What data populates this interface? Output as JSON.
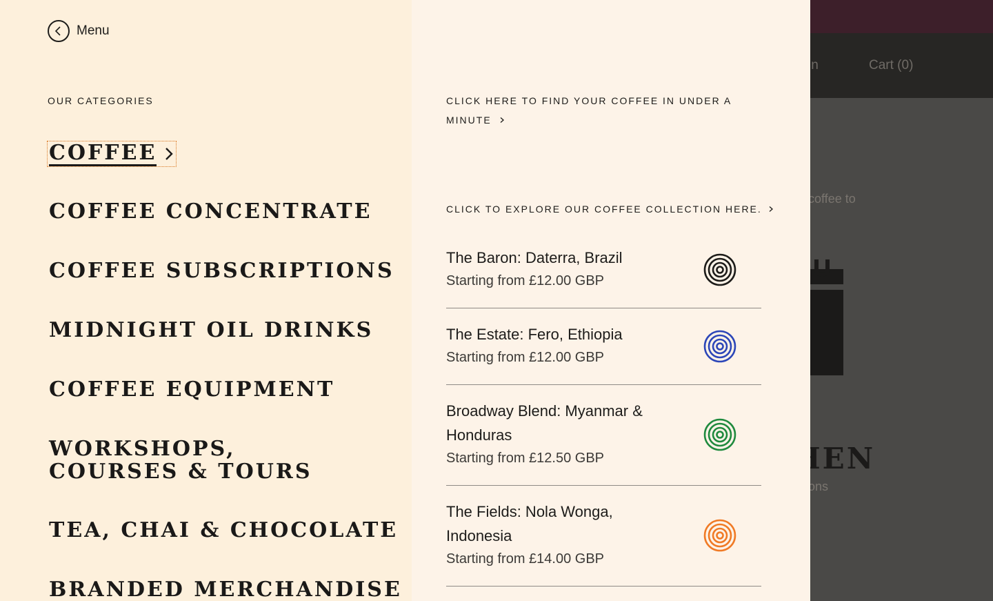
{
  "background": {
    "nav": [
      "in",
      "Cart (0)"
    ],
    "body_texts": [
      "coffee to",
      "ons"
    ],
    "heading_fragment": "HEN"
  },
  "menu": {
    "back_label": "Menu",
    "categories_label": "OUR CATEGORIES",
    "categories": [
      "COFFEE",
      "COFFEE CONCENTRATE",
      "COFFEE SUBSCRIPTIONS",
      "MIDNIGHT OIL DRINKS",
      "COFFEE EQUIPMENT",
      "WORKSHOPS, COURSES & TOURS",
      "TEA, CHAI & CHOCOLATE",
      "BRANDED MERCHANDISE"
    ]
  },
  "promo": {
    "finder_cta": "CLICK HERE TO FIND YOUR COFFEE IN UNDER A MINUTE",
    "collection_cta": "CLICK TO EXPLORE OUR COFFEE COLLECTION HERE.",
    "products": [
      {
        "name": "The Baron: Daterra, Brazil",
        "price": "Starting from £12.00 GBP",
        "color": "#1d1c1a"
      },
      {
        "name": "The Estate: Fero, Ethiopia",
        "price": "Starting from £12.00 GBP",
        "color": "#2c46b8"
      },
      {
        "name": "Broadway Blend: Myanmar & Honduras",
        "price": "Starting from £12.50 GBP",
        "color": "#1f8a3e"
      },
      {
        "name": "The Fields: Nola Wonga, Indonesia",
        "price": "Starting from £14.00 GBP",
        "color": "#f07a25"
      }
    ]
  },
  "icons": {
    "back": "chevron-left-icon",
    "arrow": "chevron-right-icon",
    "roast": "concentric-circles-icon"
  }
}
